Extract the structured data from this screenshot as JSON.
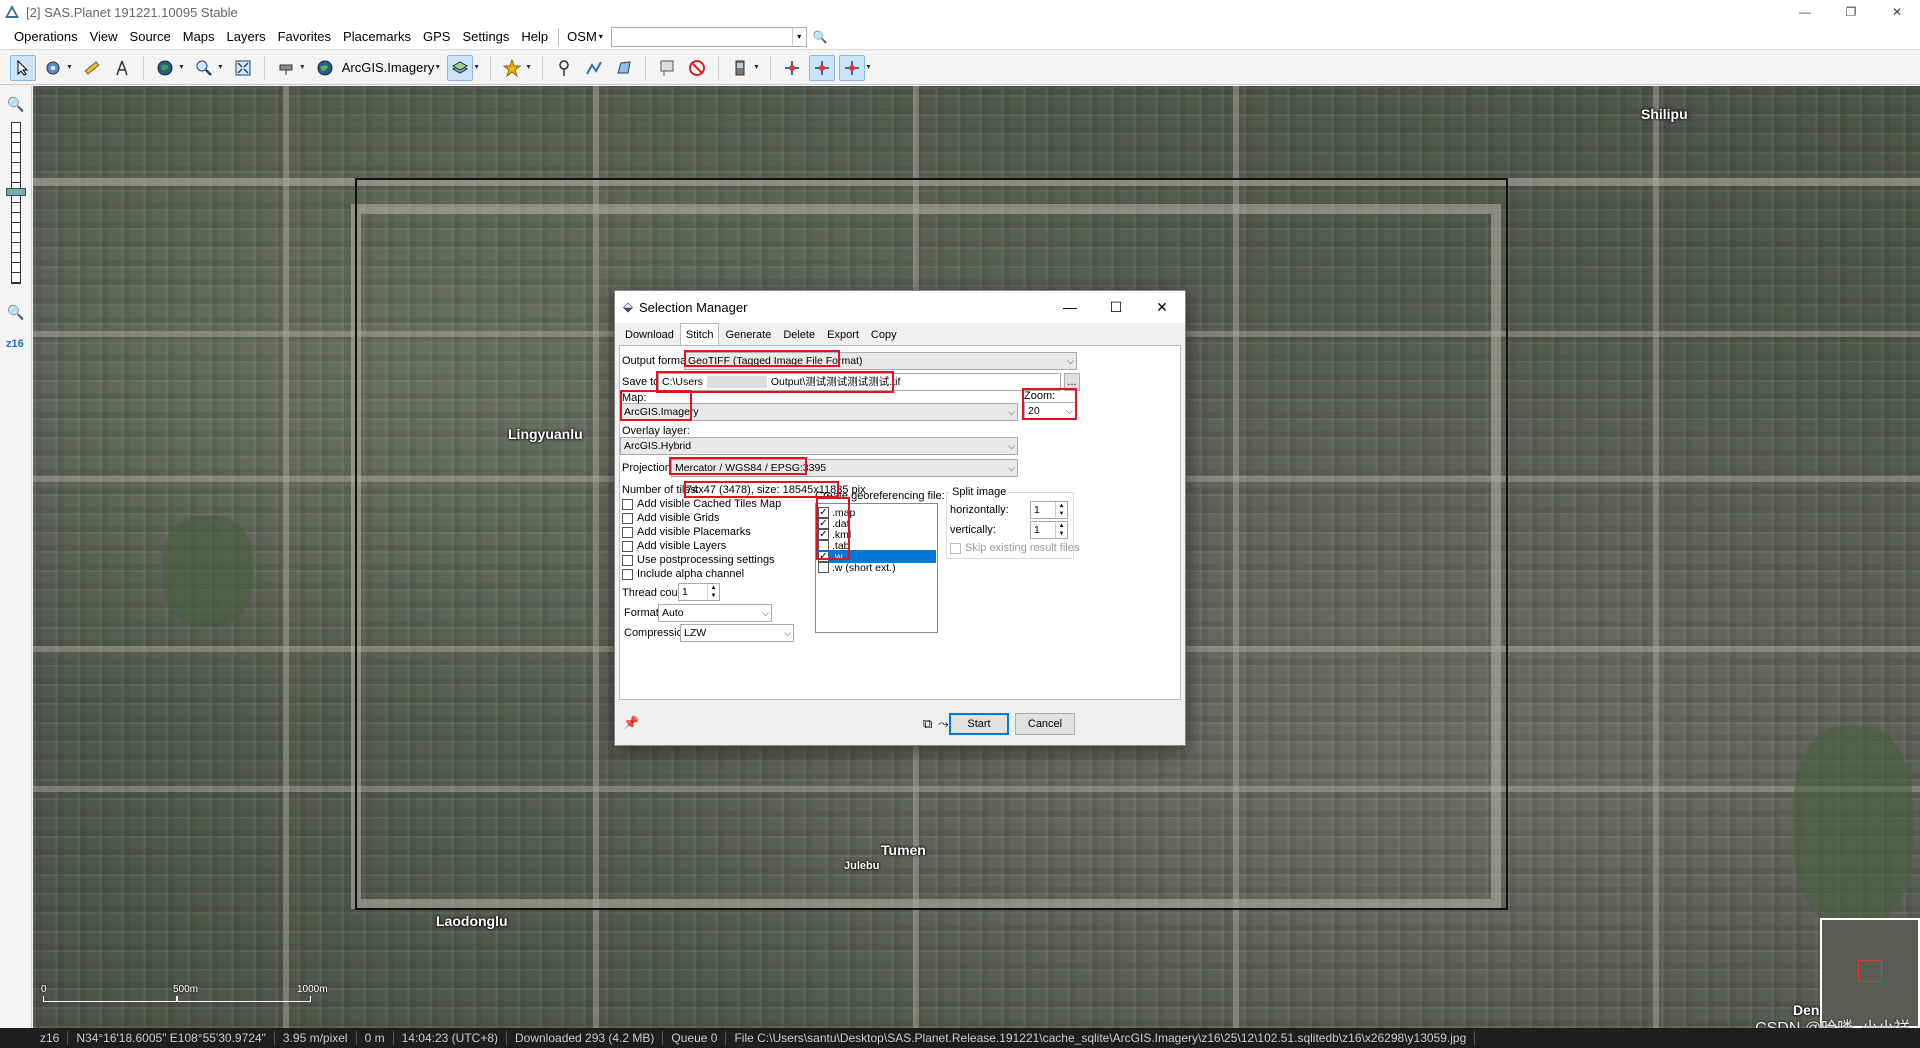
{
  "window": {
    "title": "[2] SAS.Planet 191221.10095 Stable",
    "controls": [
      "—",
      "❐",
      "✕"
    ]
  },
  "menu": {
    "items": [
      {
        "label": "Operations"
      },
      {
        "label": "View"
      },
      {
        "label": "Source"
      },
      {
        "label": "Maps"
      },
      {
        "label": "Layers"
      },
      {
        "label": "Favorites"
      },
      {
        "label": "Placemarks"
      },
      {
        "label": "GPS"
      },
      {
        "label": "Settings"
      },
      {
        "label": "Help"
      }
    ],
    "osm_label": "OSM",
    "osm_value": ""
  },
  "toolbar": {
    "map_name": "ArcGIS.Imagery",
    "icons": [
      "cursor-icon",
      "gear-icon",
      "ruler-icon",
      "compass-icon",
      "globe-icon",
      "zoom-icon",
      "fullscreen-icon",
      "satellite-icon",
      "globe-map-icon",
      "layers-icon",
      "star-icon",
      "pin-icon",
      "path-icon",
      "polygon-icon",
      "placemark-icon",
      "block-icon",
      "gps-icon",
      "gps-track-icon",
      "gps-marker-icon",
      "gps-center-icon"
    ]
  },
  "leftbar": {
    "zoom_label": "z16"
  },
  "map": {
    "labels": [
      {
        "text": "Shilipu",
        "cls": ""
      },
      {
        "text": "Lingyuanlu",
        "cls": ""
      },
      {
        "text": "Tumen",
        "cls": ""
      },
      {
        "text": "Julebu",
        "cls": "small"
      },
      {
        "text": "Laodonglu",
        "cls": ""
      },
      {
        "text": "Dengjiapo",
        "cls": ""
      }
    ],
    "scale_0": "0",
    "scale_500": "500m",
    "scale_1000": "1000m",
    "watermark": "CSDN @哈喽_小小祥"
  },
  "status": {
    "zoom": "z16",
    "coords": "N34°16'18.6005\" E108°55'30.9724\"",
    "resolution": "3.95 m/pixel",
    "distance": "0 m",
    "time": "14:04:23 (UTC+8)",
    "downloaded": "Downloaded 293 (4.2 MB)",
    "queue": "Queue 0",
    "file": "File C:\\Users\\santu\\Desktop\\SAS.Planet.Release.191221\\cache_sqlite\\ArcGIS.Imagery\\z16\\25\\12\\102.51.sqlitedb\\z16\\x26298\\y13059.jpg"
  },
  "dialog": {
    "title": "Selection Manager",
    "tabs": [
      "Download",
      "Stitch",
      "Generate",
      "Delete",
      "Export",
      "Copy"
    ],
    "active_tab": "Stitch",
    "output_format_label": "Output format:",
    "output_format": "GeoTIFF (Tagged Image File Format)",
    "save_to_label": "Save to:",
    "save_to_prefix": "C:\\Users",
    "save_to_suffix": "Output\\测试测试测试测试.tif",
    "browse": "...",
    "map_label": "Map:",
    "map_value": "ArcGIS.Imagery",
    "zoom_label": "Zoom:",
    "zoom_value": "20",
    "overlay_label": "Overlay layer:",
    "overlay_value": "ArcGIS.Hybrid",
    "projection_label": "Projection:",
    "projection_value": "Mercator / WGS84 / EPSG:3395",
    "tiles_label": "Number of tiles:",
    "tiles_value": "74x47 (3478), size: 18545x11835 pix",
    "options": [
      {
        "label": "Add visible Cached Tiles Map",
        "checked": false
      },
      {
        "label": "Add visible Grids",
        "checked": false
      },
      {
        "label": "Add visible Placemarks",
        "checked": false
      },
      {
        "label": "Add visible Layers",
        "checked": false
      },
      {
        "label": "Use postprocessing settings",
        "checked": false
      },
      {
        "label": "Include alpha channel",
        "checked": false
      }
    ],
    "thread_label": "Thread count",
    "thread_value": "1",
    "format_label": "Format:",
    "format_value": "Auto",
    "compression_label": "Compression:",
    "compression_value": "LZW",
    "georef_label": "Create georeferencing file:",
    "georef_items": [
      {
        "label": ".map",
        "checked": true
      },
      {
        "label": ".dat",
        "checked": true
      },
      {
        "label": ".kml",
        "checked": true
      },
      {
        "label": ".tab",
        "checked": false
      },
      {
        "label": ".w",
        "checked": true
      },
      {
        "label": ".w (short ext.)",
        "checked": false
      }
    ],
    "split_label": "Split image",
    "horiz_label": "horizontally:",
    "horiz_value": "1",
    "vert_label": "vertically:",
    "vert_value": "1",
    "skip_label": "Skip existing result files",
    "start": "Start",
    "cancel": "Cancel"
  }
}
